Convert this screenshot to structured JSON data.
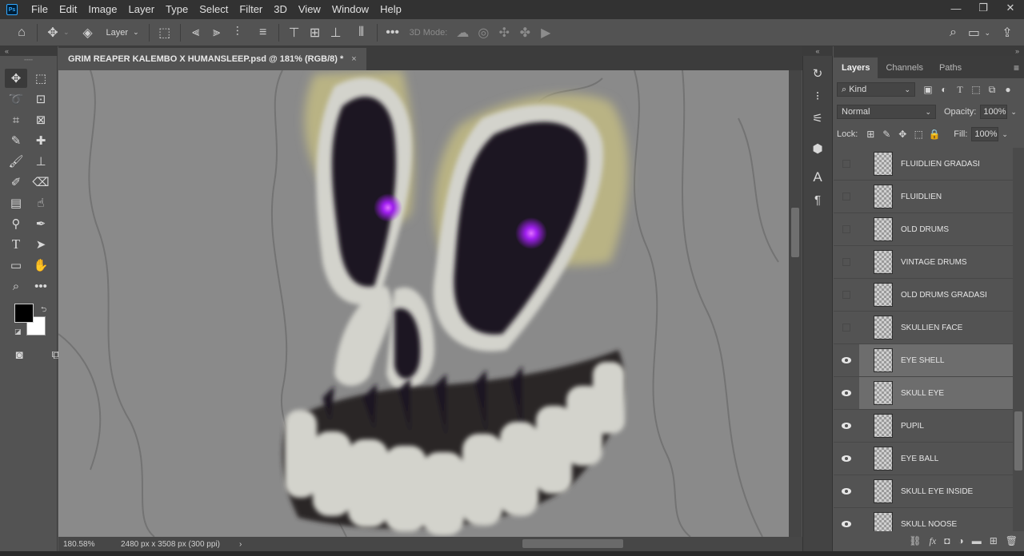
{
  "app": {
    "logo_text": "Ps"
  },
  "menu": [
    "File",
    "Edit",
    "Image",
    "Layer",
    "Type",
    "Select",
    "Filter",
    "3D",
    "View",
    "Window",
    "Help"
  ],
  "options_bar": {
    "layer_dropdown": "Layer",
    "mode_3d_label": "3D Mode:",
    "more_label": "•••"
  },
  "document": {
    "tab_title": "GRIM REAPER KALEMBO X HUMANSLEEP.psd @ 181% (RGB/8) *",
    "close_glyph": "×"
  },
  "status": {
    "zoom": "180.58%",
    "doc_size": "2480 px x 3508 px (300 ppi)",
    "arrow": "›"
  },
  "panel_tabs": [
    {
      "label": "Layers",
      "active": true
    },
    {
      "label": "Channels",
      "active": false
    },
    {
      "label": "Paths",
      "active": false
    }
  ],
  "layers_panel": {
    "filter_kind": "Kind",
    "blend_mode": "Normal",
    "opacity_label": "Opacity:",
    "opacity_value": "100%",
    "lock_label": "Lock:",
    "fill_label": "Fill:",
    "fill_value": "100%"
  },
  "layers": [
    {
      "name": "FLUIDLIEN GRADASI",
      "visible": false,
      "selected": false
    },
    {
      "name": "FLUIDLIEN",
      "visible": false,
      "selected": false
    },
    {
      "name": "OLD DRUMS",
      "visible": false,
      "selected": false
    },
    {
      "name": "VINTAGE DRUMS",
      "visible": false,
      "selected": false
    },
    {
      "name": "OLD DRUMS GRADASI",
      "visible": false,
      "selected": false
    },
    {
      "name": "SKULLIEN FACE",
      "visible": false,
      "selected": false
    },
    {
      "name": "EYE SHELL",
      "visible": true,
      "selected": true
    },
    {
      "name": "SKULL EYE",
      "visible": true,
      "selected": true
    },
    {
      "name": "PUPIL",
      "visible": true,
      "selected": false
    },
    {
      "name": "EYE BALL",
      "visible": true,
      "selected": false
    },
    {
      "name": "SKULL EYE INSIDE",
      "visible": true,
      "selected": false
    },
    {
      "name": "SKULL NOOSE",
      "visible": true,
      "selected": false
    }
  ],
  "colors": {
    "foreground": "#000000",
    "background": "#ffffff",
    "pupil": "#a020f0",
    "eye_shell": "#b9b384",
    "bone": "#d3d3cc",
    "canvas_gray": "#8a8a8a"
  }
}
